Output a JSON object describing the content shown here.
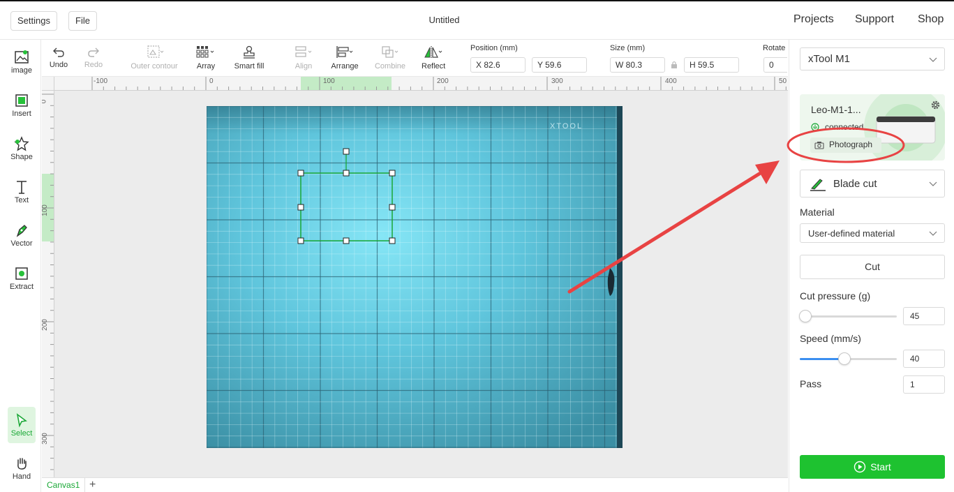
{
  "topbar": {
    "settings_label": "Settings",
    "file_label": "File",
    "doc_title": "Untitled",
    "links": [
      "Projects",
      "Support",
      "Shop"
    ]
  },
  "left_tools": [
    {
      "label": "image",
      "icon": "image-icon"
    },
    {
      "label": "Insert",
      "icon": "insert-icon"
    },
    {
      "label": "Shape",
      "icon": "shape-icon"
    },
    {
      "label": "Text",
      "icon": "text-icon"
    },
    {
      "label": "Vector",
      "icon": "vector-pen-icon"
    },
    {
      "label": "Extract",
      "icon": "extract-icon"
    },
    {
      "label": "Select",
      "icon": "select-cursor-icon",
      "active": true
    },
    {
      "label": "Hand",
      "icon": "hand-icon"
    }
  ],
  "toolbar": {
    "undo": "Undo",
    "redo": "Redo",
    "outer_contour": "Outer contour",
    "array": "Array",
    "smart_fill": "Smart fill",
    "align": "Align",
    "arrange": "Arrange",
    "combine": "Combine",
    "reflect": "Reflect",
    "position_label": "Position (mm)",
    "pos_x": "X 82.6",
    "pos_y": "Y 59.6",
    "size_label": "Size (mm)",
    "size_w": "W 80.3",
    "size_h": "H 59.5",
    "rotate_label": "Rotate",
    "rotate_value": "0"
  },
  "rulers": {
    "h_ticks": [
      "-100",
      "0",
      "100",
      "200",
      "300",
      "400",
      "50"
    ],
    "v_ticks": [
      "0",
      "100",
      "200",
      "300"
    ]
  },
  "canvas": {
    "watermark": "XTOOL",
    "tabs": [
      "Canvas1"
    ],
    "add_tab": "+"
  },
  "right_panel": {
    "machine": "xTool M1",
    "device_name": "Leo-M1-1...",
    "device_status": "connected",
    "photograph_label": "Photograph",
    "process": "Blade cut",
    "material_label": "Material",
    "material_value": "User-defined material",
    "cut_label": "Cut",
    "cut_pressure_label": "Cut pressure (g)",
    "cut_pressure_value": "45",
    "cut_pressure_fraction": 0.0,
    "speed_label": "Speed (mm/s)",
    "speed_value": "40",
    "speed_fraction": 0.46,
    "pass_label": "Pass",
    "pass_value": "1",
    "start_label": "Start"
  },
  "colors": {
    "accent": "#1ec230",
    "annotation": "#e84343",
    "selection": "#1aa836"
  }
}
